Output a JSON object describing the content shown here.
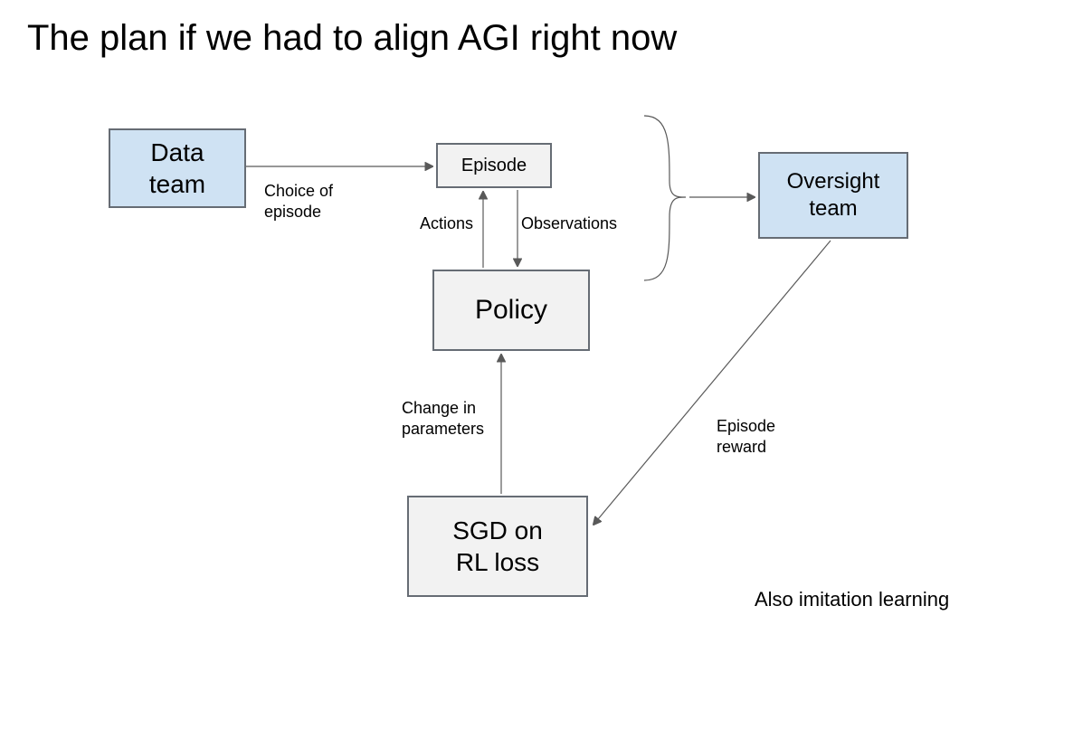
{
  "title": "The plan if we had to align AGI right now",
  "boxes": {
    "data_team": "Data\nteam",
    "episode": "Episode",
    "oversight_team": "Oversight\nteam",
    "policy": "Policy",
    "sgd": "SGD on\nRL loss"
  },
  "labels": {
    "choice_of_episode": "Choice of\nepisode",
    "actions": "Actions",
    "observations": "Observations",
    "change_in_parameters": "Change in\nparameters",
    "episode_reward": "Episode\nreward"
  },
  "footnote": "Also imitation learning",
  "colors": {
    "blue_fill": "#cfe2f3",
    "gray_fill": "#f2f2f2",
    "box_border": "#666c74",
    "arrow": "#595959"
  }
}
